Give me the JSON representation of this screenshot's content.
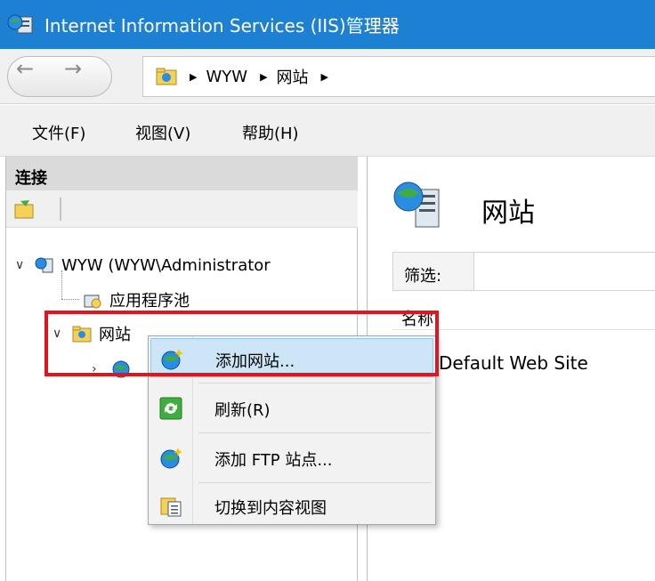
{
  "window": {
    "title": "Internet Information Services (IIS)管理器"
  },
  "address": {
    "crumbs": [
      "WYW",
      "网站"
    ]
  },
  "menu": [
    "文件(F)",
    "视图(V)",
    "帮助(H)"
  ],
  "connections": {
    "header": "连接",
    "tree": {
      "server": "WYW (WYW\\Administrator",
      "app_pools": "应用程序池",
      "sites": "网站"
    }
  },
  "main": {
    "title": "网站",
    "filter_label": "筛选:",
    "column_name": "名称",
    "site_name": "Default Web Site"
  },
  "context_menu": {
    "items": [
      {
        "label": "添加网站...",
        "icon": "globe-add-icon"
      },
      {
        "label": "刷新(R)",
        "icon": "refresh-icon"
      },
      {
        "label": "添加 FTP 站点...",
        "icon": "globe-add-icon"
      },
      {
        "label": "切换到内容视图",
        "icon": "content-view-icon"
      }
    ]
  },
  "colors": {
    "titlebar": "#1e80d2",
    "highlight_border": "#e2141d",
    "menu_hover": "#cde6f7"
  }
}
